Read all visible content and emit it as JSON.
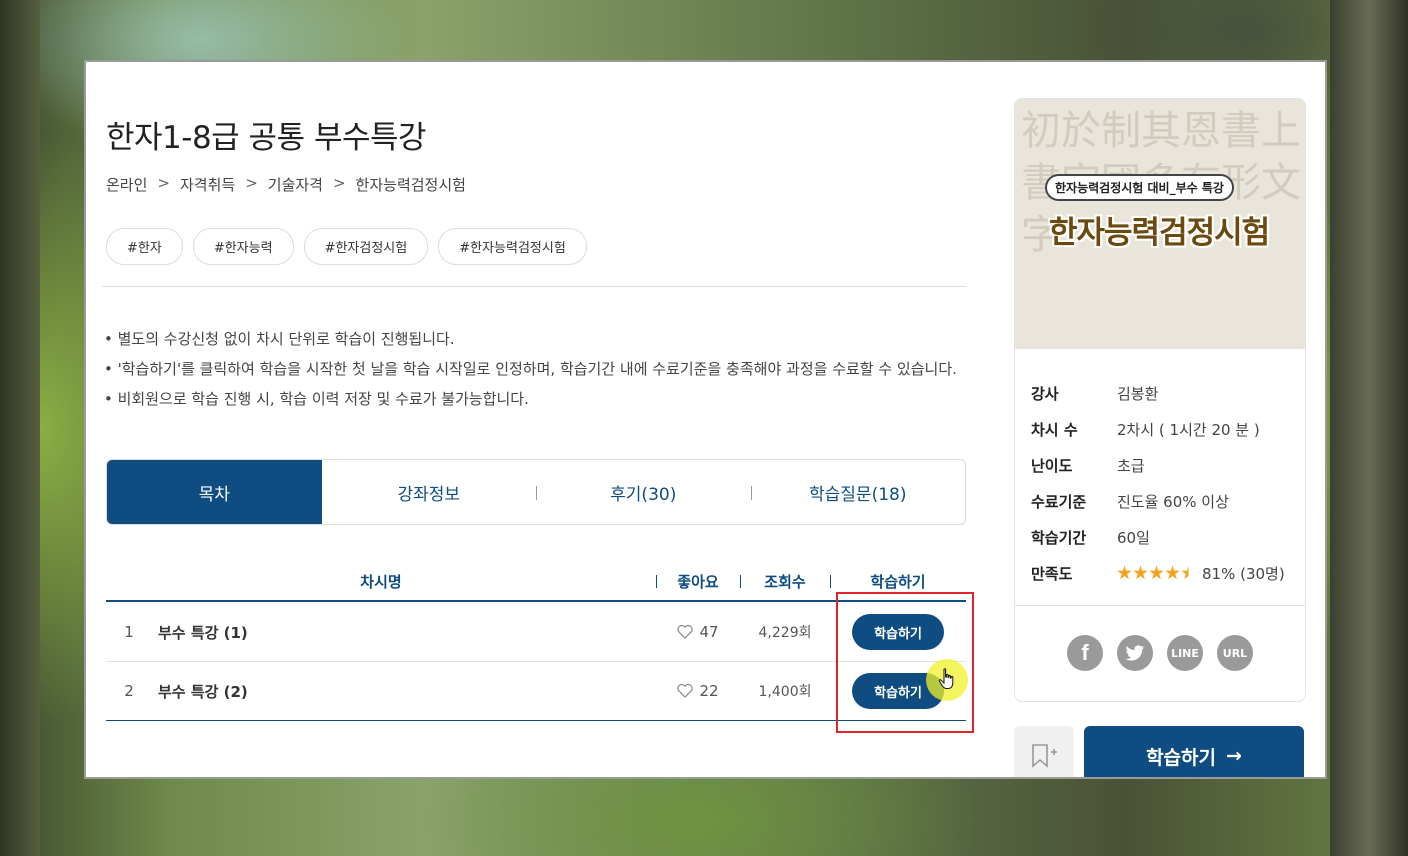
{
  "course": {
    "title": "한자1-8급 공통 부수특강",
    "breadcrumb": [
      "온라인",
      "자격취득",
      "기술자격",
      "한자능력검정시험"
    ],
    "tags": [
      "#한자",
      "#한자능력",
      "#한자검정시험",
      "#한자능력검정시험"
    ],
    "notes": [
      "• 별도의 수강신청 없이 차시 단위로 학습이 진행됩니다.",
      "• '학습하기'를 클릭하여 학습을 시작한 첫 날을 학습 시작일로 인정하며, 학습기간 내에 수료기준을 충족해야 과정을 수료할 수 있습니다.",
      "• 비회원으로 학습 진행 시, 학습 이력 저장 및 수료가 불가능합니다."
    ]
  },
  "tabs": [
    {
      "label": "목차",
      "active": true
    },
    {
      "label": "강좌정보",
      "active": false
    },
    {
      "label": "후기(30)",
      "active": false
    },
    {
      "label": "학습질문(18)",
      "active": false
    }
  ],
  "toc": {
    "headers": [
      "차시명",
      "좋아요",
      "조회수",
      "학습하기"
    ],
    "rows": [
      {
        "num": "1",
        "name": "부수 특강 (1)",
        "likes": "47",
        "views": "4,229회",
        "action": "학습하기"
      },
      {
        "num": "2",
        "name": "부수 특강 (2)",
        "likes": "22",
        "views": "1,400회",
        "action": "학습하기"
      }
    ]
  },
  "thumbnail": {
    "subtitle": "한자능력검정시험 대비_부수 특강",
    "headline": "한자능력검정시험",
    "background_glyphs": "初於制其恩書上書字國多有形文字"
  },
  "info": [
    {
      "key": "강사",
      "value": "김봉환"
    },
    {
      "key": "차시 수",
      "value": "2차시 ( 1시간 20 분 )"
    },
    {
      "key": "난이도",
      "value": "초급"
    },
    {
      "key": "수료기준",
      "value": "진도율 60% 이상"
    },
    {
      "key": "학습기간",
      "value": "60일"
    },
    {
      "key": "만족도",
      "value": "81% (30명)",
      "stars": 4.5
    }
  ],
  "share": [
    "facebook-icon",
    "twitter-icon",
    "line-icon",
    "url-icon"
  ],
  "share_labels": {
    "line": "LINE",
    "url": "URL"
  },
  "cta": {
    "label": "학습하기",
    "arrow": "→"
  },
  "colors": {
    "primary": "#0f4c81",
    "highlight_box": "#e0242c",
    "star": "#f4a21a"
  }
}
